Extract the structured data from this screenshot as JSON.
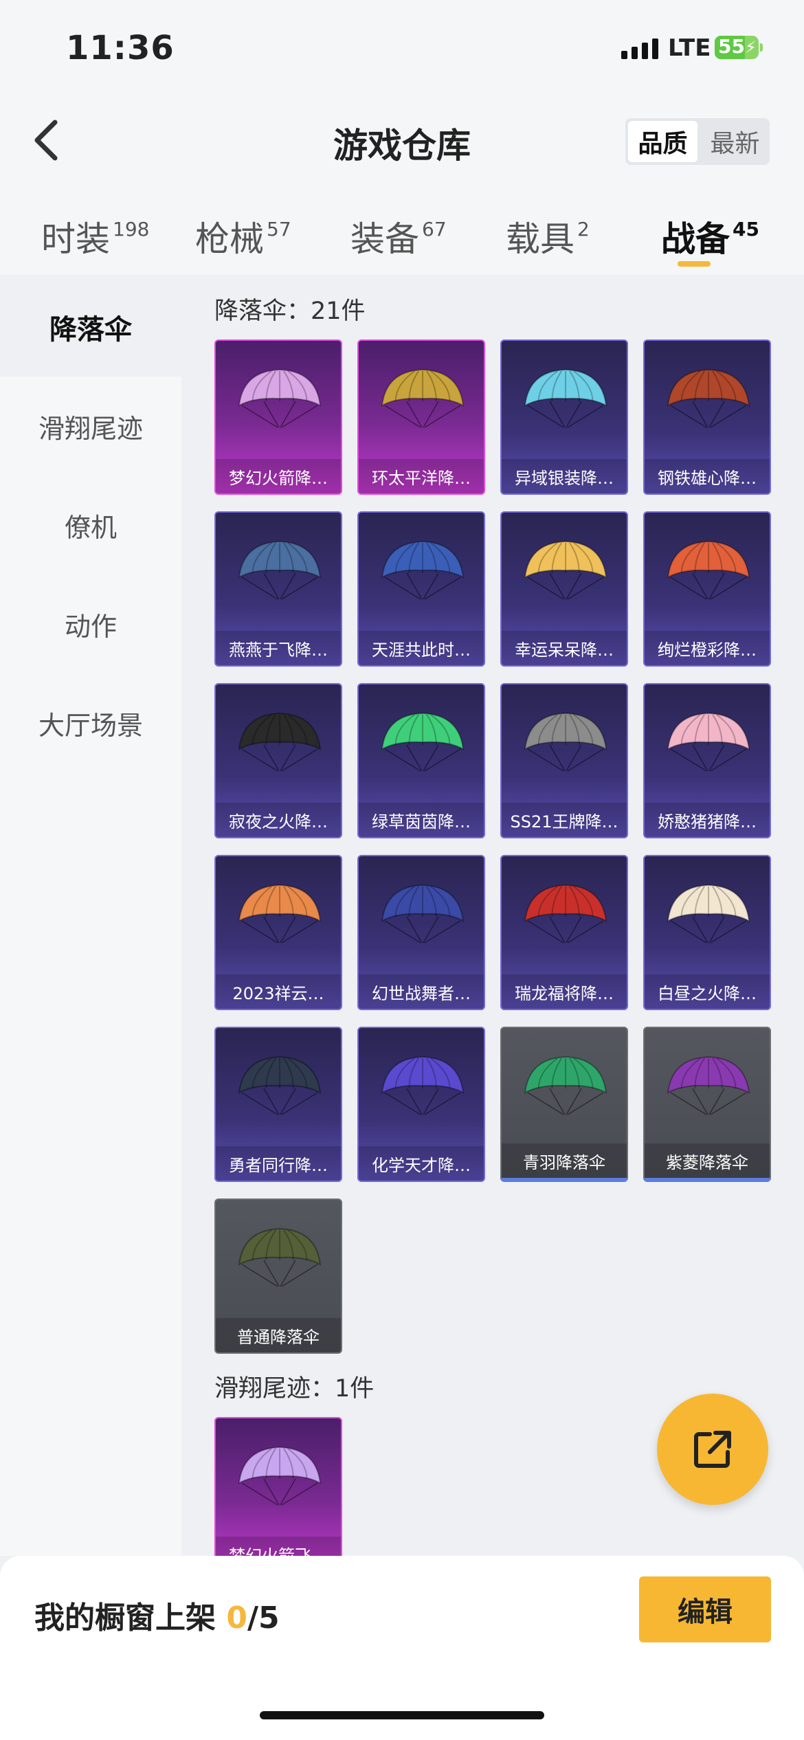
{
  "status": {
    "time": "11:36",
    "network": "LTE",
    "battery": "55"
  },
  "header": {
    "title": "游戏仓库",
    "sort_quality": "品质",
    "sort_newest": "最新"
  },
  "tabs": [
    {
      "label": "时装",
      "count": "198"
    },
    {
      "label": "枪械",
      "count": "57"
    },
    {
      "label": "装备",
      "count": "67"
    },
    {
      "label": "载具",
      "count": "2"
    },
    {
      "label": "战备",
      "count": "45"
    }
  ],
  "categories": [
    "降落伞",
    "滑翔尾迹",
    "僚机",
    "动作",
    "大厅场景"
  ],
  "sections": {
    "parachute_header": "降落伞：21件",
    "trail_header": "滑翔尾迹：1件"
  },
  "items": [
    {
      "name": "梦幻火箭降…",
      "rarity": "pink",
      "color": "#d9a6e6"
    },
    {
      "name": "环太平洋降…",
      "rarity": "pink",
      "color": "#c9a43c"
    },
    {
      "name": "异域银装降…",
      "rarity": "purple",
      "color": "#6ed0e6"
    },
    {
      "name": "钢铁雄心降…",
      "rarity": "purple",
      "color": "#b0472a"
    },
    {
      "name": "燕燕于飞降…",
      "rarity": "purple",
      "color": "#4a6fa0"
    },
    {
      "name": "天涯共此时…",
      "rarity": "purple",
      "color": "#3b5fb8"
    },
    {
      "name": "幸运呆呆降…",
      "rarity": "purple",
      "color": "#f0c15a"
    },
    {
      "name": "绚烂橙彩降…",
      "rarity": "purple",
      "color": "#e2603a"
    },
    {
      "name": "寂夜之火降…",
      "rarity": "purple",
      "color": "#2a2a2a"
    },
    {
      "name": "绿草茵茵降…",
      "rarity": "purple",
      "color": "#3fcf7a"
    },
    {
      "name": "SS21王牌降…",
      "rarity": "purple",
      "color": "#8c8c8c"
    },
    {
      "name": "娇憨猪猪降…",
      "rarity": "purple",
      "color": "#f2b6c8"
    },
    {
      "name": "2023祥云…",
      "rarity": "purple",
      "color": "#e98a4a"
    },
    {
      "name": "幻世战舞者…",
      "rarity": "purple",
      "color": "#3a4aa6"
    },
    {
      "name": "瑞龙福将降…",
      "rarity": "purple",
      "color": "#c9302c"
    },
    {
      "name": "白昼之火降…",
      "rarity": "purple",
      "color": "#f2e6d0"
    },
    {
      "name": "勇者同行降…",
      "rarity": "purple",
      "color": "#2f3a4e"
    },
    {
      "name": "化学天才降…",
      "rarity": "purple",
      "color": "#5a4ad0"
    },
    {
      "name": "青羽降落伞",
      "rarity": "gray",
      "color": "#2ea66a"
    },
    {
      "name": "紫菱降落伞",
      "rarity": "gray",
      "color": "#8a3ab0"
    },
    {
      "name": "普通降落伞",
      "rarity": "gray-plain",
      "color": "#556038"
    }
  ],
  "trail_items": [
    {
      "name": "梦幻火箭飞…",
      "rarity": "pink",
      "color": "#c9a6f0"
    }
  ],
  "shelf": {
    "label": "我的橱窗上架 ",
    "current": "0",
    "total": "/5"
  },
  "edit_label": "编辑",
  "accent_color": "#f7b733"
}
